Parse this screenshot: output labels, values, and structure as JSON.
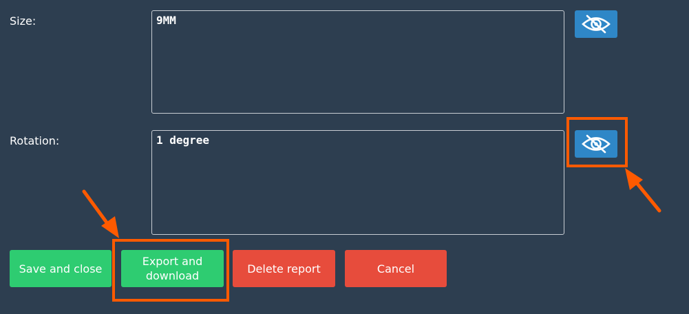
{
  "form": {
    "size": {
      "label": "Size:",
      "value": "9MM",
      "visibility_icon": "eye-slash-icon"
    },
    "rotation": {
      "label": "Rotation:",
      "value": "1 degree",
      "visibility_icon": "eye-slash-icon"
    }
  },
  "actions": {
    "save_label": "Save and close",
    "export_label_line1": "Export and",
    "export_label_line2": "download",
    "delete_label": "Delete report",
    "cancel_label": "Cancel"
  },
  "annotations": {
    "highlights": [
      "rotation-visibility-toggle",
      "export-download-button"
    ],
    "arrow_icon": "arrow-icon"
  },
  "colors": {
    "background": "#2d3e50",
    "field_border": "#c9ced4",
    "eye_button": "#2f87c7",
    "success": "#2ecc71",
    "danger": "#e74c3c",
    "annotation": "#ff5a00"
  }
}
